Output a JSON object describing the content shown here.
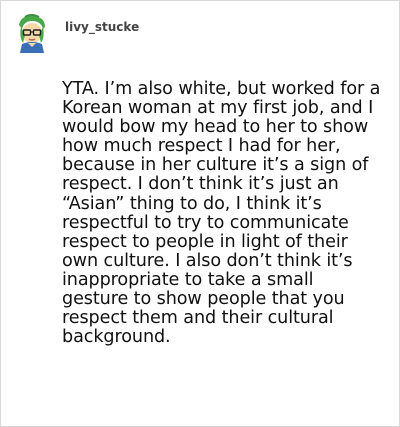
{
  "post": {
    "username": "livy_stucke",
    "avatar_icon": "avatar-icon",
    "body": "YTA. I’m also white, but worked for a Korean woman at my first job, and I would bow my head to her to show how much respect I had for her, because in her culture it’s a sign of respect. I don’t think it’s just an “Asian” thing to do, I think it’s respectful to try to communicate respect to people in light of their own culture. I also don’t think it’s inappropriate to take a small gesture to show people that you respect them and their cultural background."
  },
  "colors": {
    "border": "#d8d8d8",
    "username": "#444444",
    "text": "#111111",
    "avatar_green": "#49a84a",
    "avatar_skin": "#f3d9a8"
  }
}
